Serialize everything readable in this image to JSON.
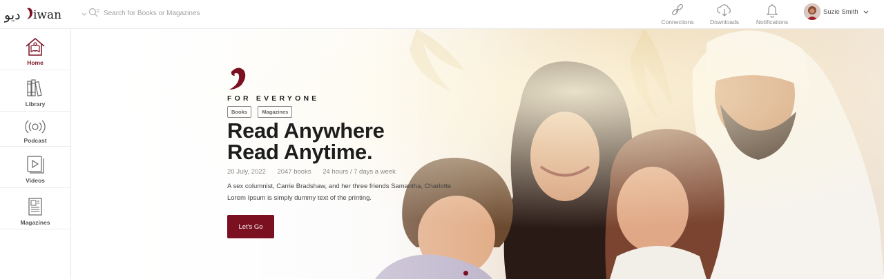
{
  "app": {
    "logo_text": "ديوان",
    "logo_mark": "D",
    "logo_suffix": "iwan"
  },
  "search": {
    "placeholder": "Search for Books or Magazines"
  },
  "header": {
    "connections_label": "Connections",
    "downloads_label": "Downloads",
    "notifications_label": "Notifications",
    "user_name": "Suzie Smith"
  },
  "sidebar": {
    "items": [
      {
        "label": "Home",
        "icon": "home-book-icon",
        "active": true
      },
      {
        "label": "Library",
        "icon": "books-icon",
        "active": false
      },
      {
        "label": "Podcast",
        "icon": "broadcast-icon",
        "active": false
      },
      {
        "label": "Videos",
        "icon": "video-play-icon",
        "active": false
      },
      {
        "label": "Magazines",
        "icon": "magazine-icon",
        "active": false
      }
    ]
  },
  "hero": {
    "tagline": "FOR EVERYONE",
    "chips": [
      "Books",
      "Magazines"
    ],
    "headline_line1": "Read Anywhere",
    "headline_line2": "Read Anytime.",
    "meta": [
      "20 July, 2022",
      "2047 books",
      "24 hours / 7 days a week"
    ],
    "description": "A sex columnist, Carrie Bradshaw, and her three friends Samantha, Charlotte Lorem Ipsum is simply dummy text of the printing.",
    "cta_label": "Let's Go",
    "slides_count": 1,
    "active_slide": 1
  },
  "colors": {
    "brand": "#7b1020",
    "text_dark": "#1d1d1d",
    "muted": "#8a8a8a"
  }
}
